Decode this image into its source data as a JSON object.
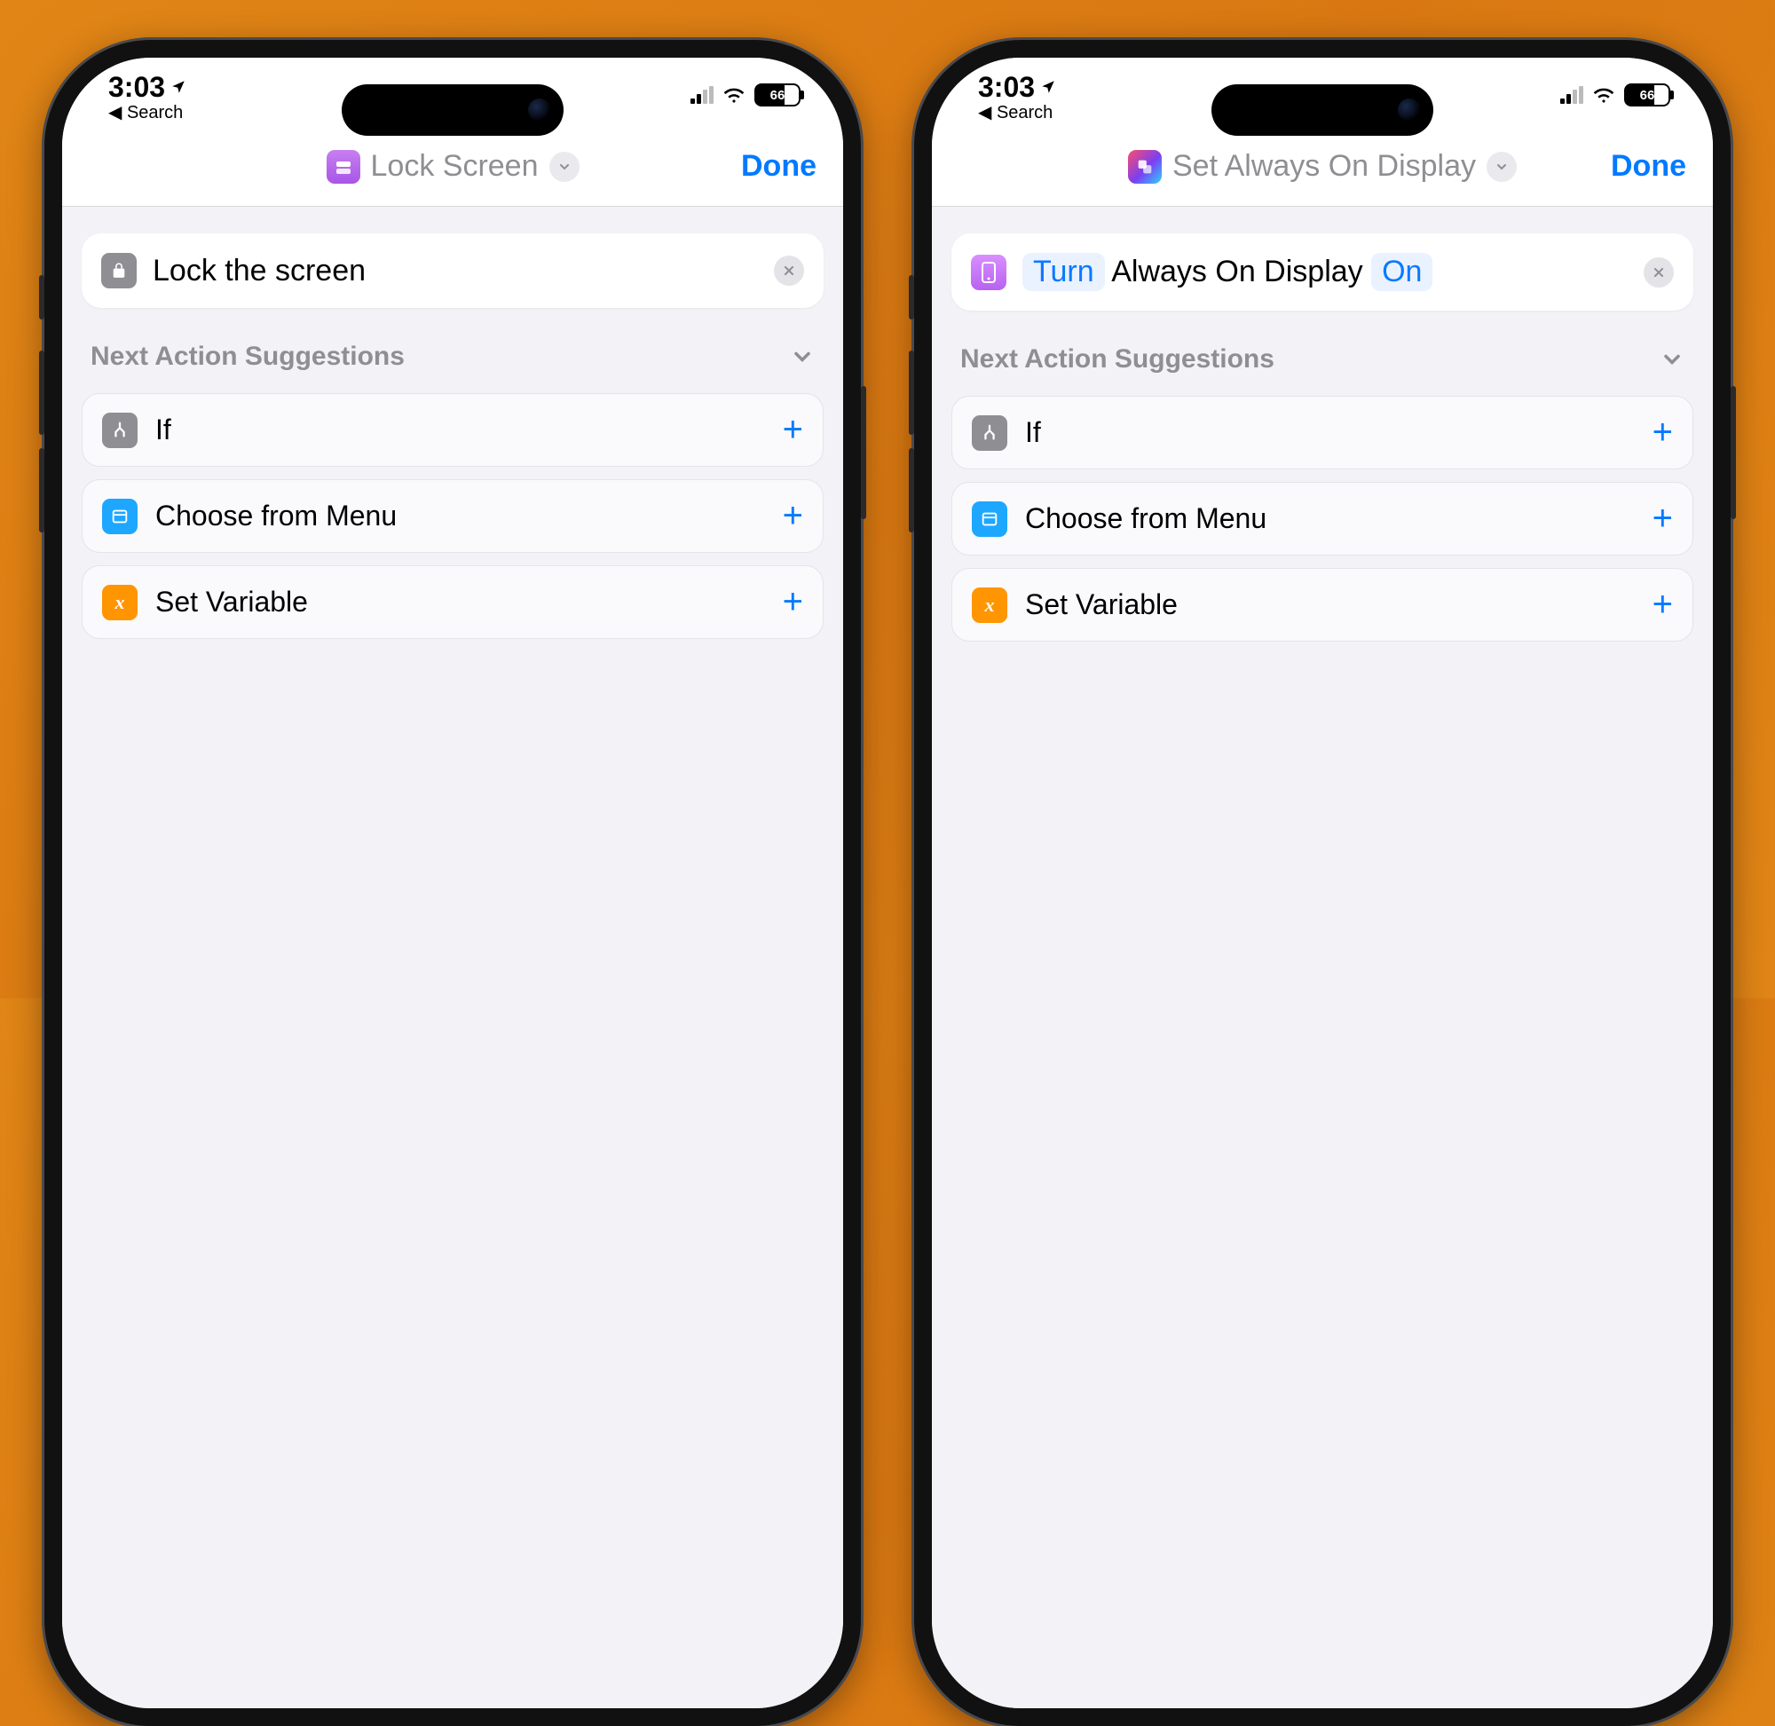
{
  "left": {
    "status": {
      "time": "3:03",
      "back": "Search",
      "battery": "66"
    },
    "header": {
      "title": "Lock Screen",
      "done": "Done"
    },
    "action": {
      "text": "Lock the screen"
    },
    "suggestions_title": "Next Action Suggestions",
    "suggestions": [
      {
        "label": "If"
      },
      {
        "label": "Choose from Menu"
      },
      {
        "label": "Set Variable"
      }
    ]
  },
  "right": {
    "status": {
      "time": "3:03",
      "back": "Search",
      "battery": "66"
    },
    "header": {
      "title": "Set Always On Display",
      "done": "Done"
    },
    "action": {
      "pill1": "Turn",
      "mid": "Always On Display",
      "pill2": "On"
    },
    "suggestions_title": "Next Action Suggestions",
    "suggestions": [
      {
        "label": "If"
      },
      {
        "label": "Choose from Menu"
      },
      {
        "label": "Set Variable"
      }
    ]
  }
}
